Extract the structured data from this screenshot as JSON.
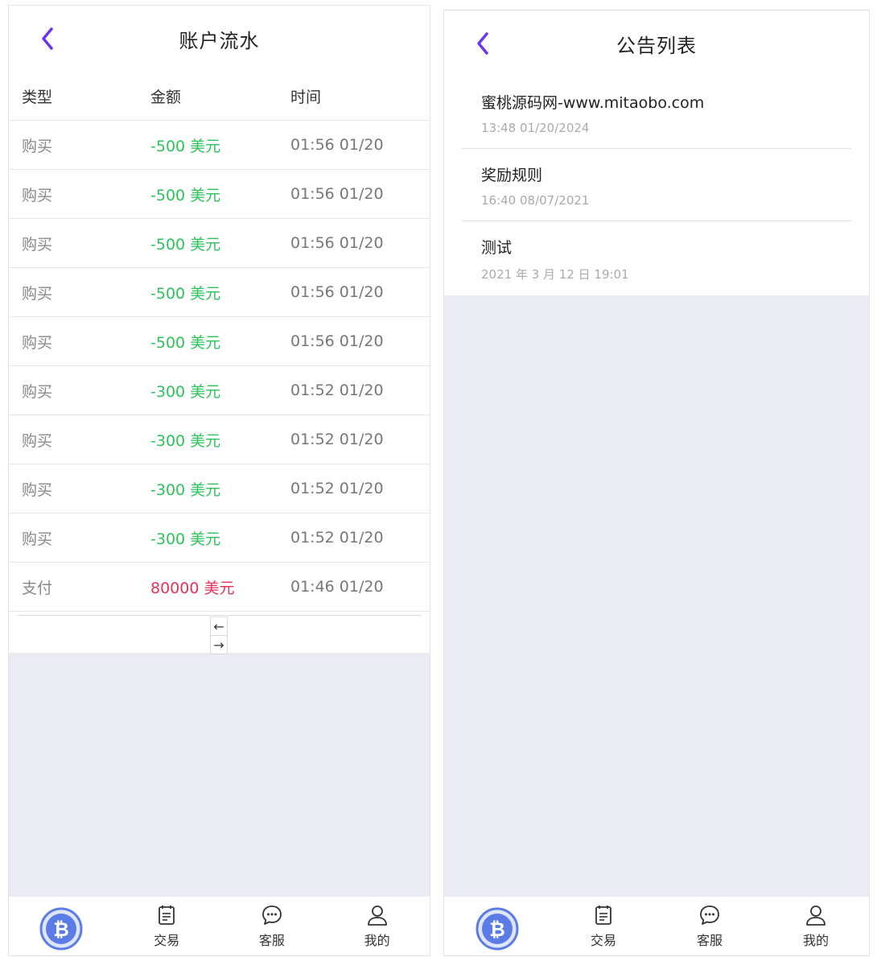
{
  "colors": {
    "accent": "#6a38e8",
    "negative_amount": "#2ec25b",
    "positive_amount": "#e8325a",
    "background": "#ebebf4",
    "btc": "#5b7ce6"
  },
  "ledger_screen": {
    "title": "账户流水",
    "back_icon": "chevron-left-icon",
    "columns": [
      "类型",
      "金额",
      "时间"
    ],
    "rows": [
      {
        "type": "购买",
        "amount": "-500 美元",
        "time": "01:56 01/20",
        "sign": "neg"
      },
      {
        "type": "购买",
        "amount": "-500 美元",
        "time": "01:56 01/20",
        "sign": "neg"
      },
      {
        "type": "购买",
        "amount": "-500 美元",
        "time": "01:56 01/20",
        "sign": "neg"
      },
      {
        "type": "购买",
        "amount": "-500 美元",
        "time": "01:56 01/20",
        "sign": "neg"
      },
      {
        "type": "购买",
        "amount": "-500 美元",
        "time": "01:56 01/20",
        "sign": "neg"
      },
      {
        "type": "购买",
        "amount": "-300 美元",
        "time": "01:52 01/20",
        "sign": "neg"
      },
      {
        "type": "购买",
        "amount": "-300 美元",
        "time": "01:52 01/20",
        "sign": "neg"
      },
      {
        "type": "购买",
        "amount": "-300 美元",
        "time": "01:52 01/20",
        "sign": "neg"
      },
      {
        "type": "购买",
        "amount": "-300 美元",
        "time": "01:52 01/20",
        "sign": "neg"
      },
      {
        "type": "支付",
        "amount": "80000 美元",
        "time": "01:46 01/20",
        "sign": "pos"
      }
    ],
    "pager": {
      "prev": "←",
      "next": "→"
    }
  },
  "notice_screen": {
    "title": "公告列表",
    "back_icon": "chevron-left-icon",
    "items": [
      {
        "title": "蜜桃源码网-www.mitaobo.com",
        "time": "13:48 01/20/2024"
      },
      {
        "title": "奖励规则",
        "time": "16:40 08/07/2021"
      },
      {
        "title": "测试",
        "time": "2021 年 3 月 12 日 19:01"
      }
    ]
  },
  "tabbar": {
    "items": [
      {
        "label": "",
        "icon": "bitcoin-icon"
      },
      {
        "label": "交易",
        "icon": "document-icon"
      },
      {
        "label": "客服",
        "icon": "chat-bubble-icon"
      },
      {
        "label": "我的",
        "icon": "user-icon"
      }
    ]
  }
}
